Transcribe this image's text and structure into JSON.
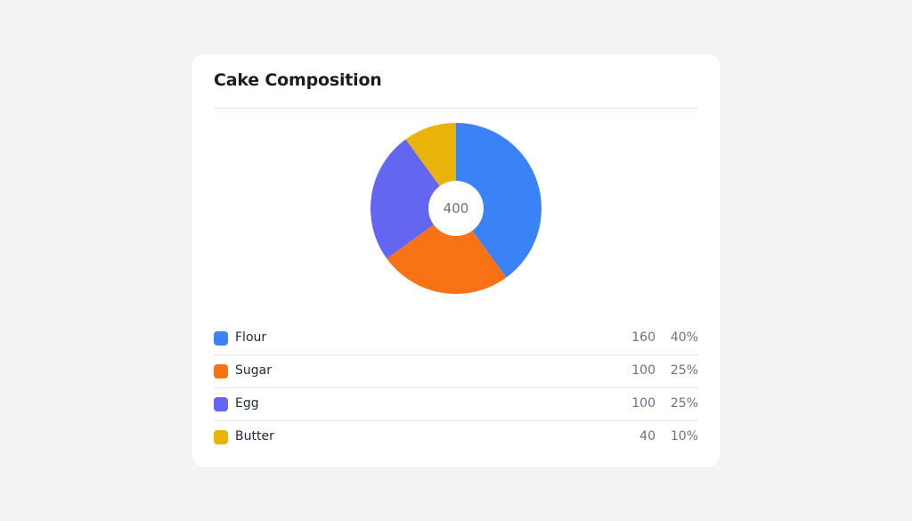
{
  "card": {
    "title": "Cake Composition"
  },
  "chart_data": {
    "type": "pie",
    "title": "Cake Composition",
    "center_label": "400",
    "total": 400,
    "donut": true,
    "categories": [
      "Flour",
      "Sugar",
      "Egg",
      "Butter"
    ],
    "values": [
      160,
      100,
      100,
      40
    ],
    "percentages": [
      "40%",
      "25%",
      "25%",
      "10%"
    ],
    "colors": [
      "#3b82f6",
      "#f97316",
      "#6366f1",
      "#eab308"
    ],
    "start": "top",
    "direction": "clockwise"
  },
  "legend": [
    {
      "label": "Flour",
      "value": "160",
      "percent": "40%",
      "color": "#3b82f6"
    },
    {
      "label": "Sugar",
      "value": "100",
      "percent": "25%",
      "color": "#f97316"
    },
    {
      "label": "Egg",
      "value": "100",
      "percent": "25%",
      "color": "#6366f1"
    },
    {
      "label": "Butter",
      "value": "40",
      "percent": "10%",
      "color": "#eab308"
    }
  ]
}
